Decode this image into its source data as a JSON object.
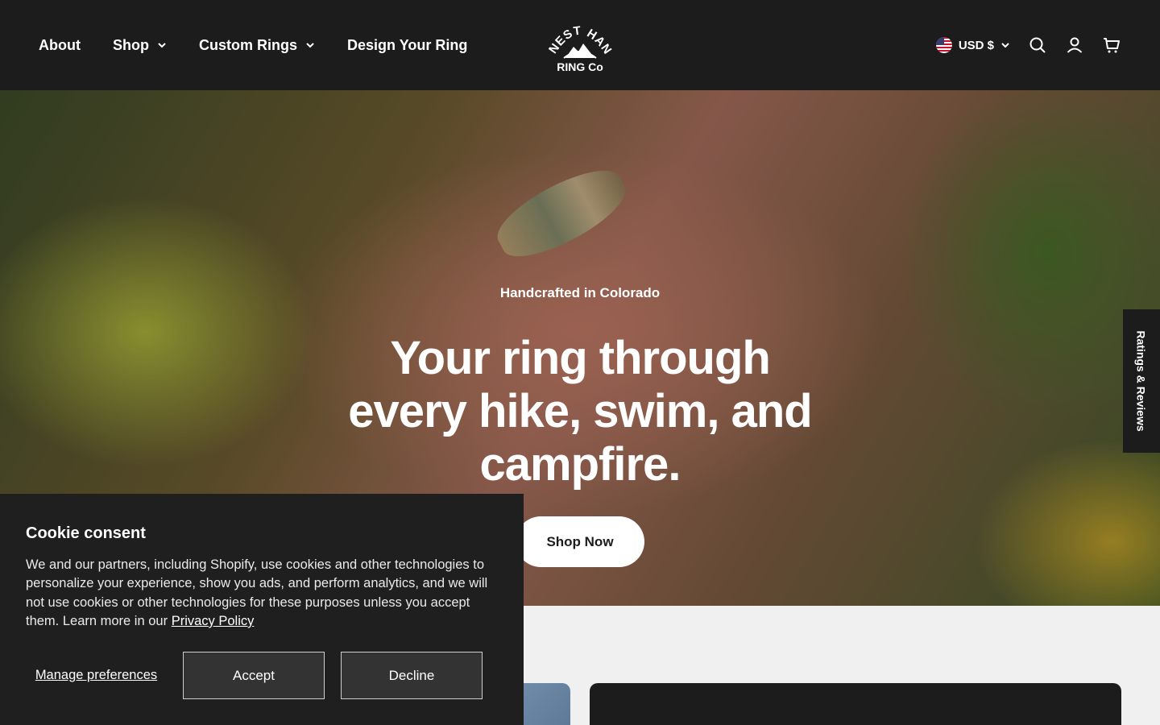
{
  "header": {
    "nav": [
      {
        "label": "About",
        "has_dropdown": false
      },
      {
        "label": "Shop",
        "has_dropdown": true
      },
      {
        "label": "Custom Rings",
        "has_dropdown": true
      },
      {
        "label": "Design Your Ring",
        "has_dropdown": false
      }
    ],
    "logo": {
      "line1": "HONEST HANDS",
      "line2": "RING Co"
    },
    "currency": "USD $",
    "icons": [
      "us-flag-icon",
      "chevron-down-icon",
      "search-icon",
      "account-icon",
      "cart-icon"
    ]
  },
  "hero": {
    "eyebrow": "Handcrafted in Colorado",
    "headline": "Your ring through every hike, swim, and campfire.",
    "cta": "Shop Now"
  },
  "reviews_tab": {
    "label": "Ratings & Reviews"
  },
  "cookie": {
    "title": "Cookie consent",
    "body": "We and our partners, including Shopify, use cookies and other technologies to personalize your experience, show you ads, and perform analytics, and we will not use cookies or other technologies for these purposes unless you accept them. Learn more in our",
    "link": "Privacy Policy",
    "manage": "Manage preferences",
    "accept": "Accept",
    "decline": "Decline"
  },
  "colors": {
    "header_bg": "#1c1c1c",
    "banner_bg": "#1f1f1f",
    "page_bg": "#f0f0f0",
    "cta_bg": "#ffffff"
  }
}
